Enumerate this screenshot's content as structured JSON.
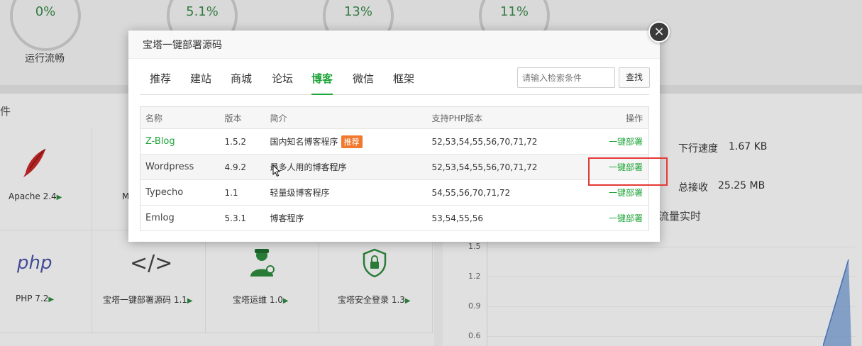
{
  "background": {
    "gauges": [
      {
        "value": "0%",
        "label": "运行流畅"
      },
      {
        "value": "5.1%"
      },
      {
        "value": "13%"
      },
      {
        "value": "11%"
      }
    ],
    "software_panel_title": "件",
    "software": [
      {
        "name": "Apache 2.4",
        "icon": "feather-icon"
      },
      {
        "name": "M",
        "icon": ""
      },
      {
        "name": "PHP 7.2",
        "icon": "php-icon"
      },
      {
        "name": "宝塔一键部署源码 1.1",
        "icon": "code-icon"
      },
      {
        "name": "宝塔运维 1.0",
        "icon": "engineer-icon"
      },
      {
        "name": "宝塔安全登录 1.3",
        "icon": "shield-lock-icon"
      }
    ],
    "network": {
      "down_speed_label": "下行速度",
      "down_speed_value": "1.67 KB",
      "total_recv_label": "总接收",
      "total_recv_value": "25.25 MB",
      "flow_title": "流量实时"
    },
    "chart_ticks": [
      "1.5",
      "1.2",
      "0.9",
      "0.6"
    ]
  },
  "modal": {
    "title": "宝塔一键部署源码",
    "close_icon": "close-icon",
    "tabs": [
      "推荐",
      "建站",
      "商城",
      "论坛",
      "博客",
      "微信",
      "框架"
    ],
    "active_tab": "博客",
    "search": {
      "placeholder": "请输入检索条件",
      "button": "查找"
    },
    "table": {
      "headers": [
        "名称",
        "版本",
        "简介",
        "支持PHP版本",
        "操作"
      ],
      "rows": [
        {
          "name": "Z-Blog",
          "version": "1.5.2",
          "desc": "国内知名博客程序",
          "badge": "推荐",
          "php": "52,53,54,55,56,70,71,72",
          "action": "一键部署"
        },
        {
          "name": "Wordpress",
          "version": "4.9.2",
          "desc": "最多人用的博客程序",
          "php": "52,53,54,55,56,70,71,72",
          "action": "一键部署"
        },
        {
          "name": "Typecho",
          "version": "1.1",
          "desc": "轻量级博客程序",
          "php": "54,55,56,70,71,72",
          "action": "一键部署"
        },
        {
          "name": "Emlog",
          "version": "5.3.1",
          "desc": "博客程序",
          "php": "53,54,55,56",
          "action": "一键部署"
        }
      ]
    }
  },
  "colors": {
    "accent": "#20a53a",
    "badge": "#f0792e",
    "highlight": "#e53935"
  }
}
